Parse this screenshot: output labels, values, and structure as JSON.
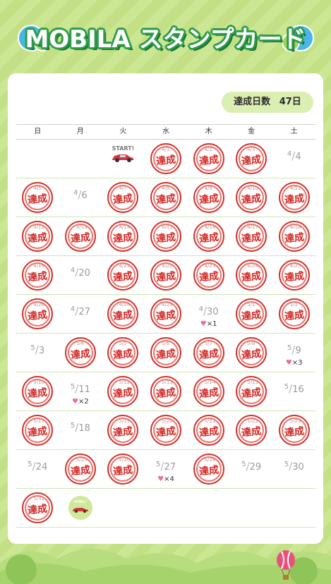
{
  "header": {
    "title": "MOBILA スタンプカード"
  },
  "badge": {
    "label": "達成日数",
    "value": "47日"
  },
  "weekdays": [
    "日",
    "月",
    "火",
    "水",
    "木",
    "金",
    "土"
  ],
  "stamp_text": "達成",
  "start_label": "START!",
  "goal_label": "GOAL!",
  "calendar": [
    [
      {
        "t": "empty"
      },
      {
        "t": "empty"
      },
      {
        "t": "start"
      },
      {
        "t": "stamp",
        "d": "4/1"
      },
      {
        "t": "stamp",
        "d": "4/2"
      },
      {
        "t": "stamp",
        "d": "4/3"
      },
      {
        "t": "date",
        "m": "4",
        "d": "4"
      }
    ],
    [
      {
        "t": "stamp",
        "d": "4/5"
      },
      {
        "t": "date",
        "m": "4",
        "d": "6"
      },
      {
        "t": "stamp",
        "d": "4/7"
      },
      {
        "t": "stamp",
        "d": "4/8"
      },
      {
        "t": "stamp",
        "d": "4/9"
      },
      {
        "t": "stamp",
        "d": "4/10"
      },
      {
        "t": "stamp",
        "d": "4/11"
      }
    ],
    [
      {
        "t": "stamp",
        "d": "4/12"
      },
      {
        "t": "stamp",
        "d": "4/13"
      },
      {
        "t": "stamp",
        "d": "4/14"
      },
      {
        "t": "stamp",
        "d": "4/15"
      },
      {
        "t": "stamp",
        "d": "4/16"
      },
      {
        "t": "stamp",
        "d": "4/17"
      },
      {
        "t": "stamp",
        "d": "4/18"
      }
    ],
    [
      {
        "t": "stamp",
        "d": "4/19"
      },
      {
        "t": "date",
        "m": "4",
        "d": "20"
      },
      {
        "t": "stamp",
        "d": "4/21"
      },
      {
        "t": "stamp",
        "d": "4/22"
      },
      {
        "t": "stamp",
        "d": "4/23"
      },
      {
        "t": "stamp",
        "d": "4/24"
      },
      {
        "t": "stamp",
        "d": "4/25"
      }
    ],
    [
      {
        "t": "stamp",
        "d": "4/26"
      },
      {
        "t": "date",
        "m": "4",
        "d": "27"
      },
      {
        "t": "stamp",
        "d": "4/28"
      },
      {
        "t": "stamp",
        "d": "4/29"
      },
      {
        "t": "date",
        "m": "4",
        "d": "30",
        "h": "×1"
      },
      {
        "t": "stamp",
        "d": "5/1"
      },
      {
        "t": "stamp",
        "d": "5/2"
      }
    ],
    [
      {
        "t": "date",
        "m": "5",
        "d": "3"
      },
      {
        "t": "stamp",
        "d": "5/4"
      },
      {
        "t": "stamp",
        "d": "5/5"
      },
      {
        "t": "stamp",
        "d": "5/6"
      },
      {
        "t": "stamp",
        "d": "5/7"
      },
      {
        "t": "stamp",
        "d": "5/8"
      },
      {
        "t": "date",
        "m": "5",
        "d": "9",
        "h": "×3"
      }
    ],
    [
      {
        "t": "stamp",
        "d": "5/10"
      },
      {
        "t": "date",
        "m": "5",
        "d": "11",
        "h": "×2"
      },
      {
        "t": "stamp",
        "d": "5/12"
      },
      {
        "t": "stamp",
        "d": "5/13"
      },
      {
        "t": "stamp",
        "d": "5/14"
      },
      {
        "t": "stamp",
        "d": "5/15"
      },
      {
        "t": "date",
        "m": "5",
        "d": "16"
      }
    ],
    [
      {
        "t": "stamp",
        "d": "5/17"
      },
      {
        "t": "date",
        "m": "5",
        "d": "18"
      },
      {
        "t": "stamp",
        "d": "5/19"
      },
      {
        "t": "stamp",
        "d": "5/20"
      },
      {
        "t": "stamp",
        "d": "5/21"
      },
      {
        "t": "stamp",
        "d": "5/22"
      },
      {
        "t": "stamp",
        "d": "5/23"
      }
    ],
    [
      {
        "t": "date",
        "m": "5",
        "d": "24"
      },
      {
        "t": "stamp",
        "d": "5/25"
      },
      {
        "t": "stamp",
        "d": "5/26"
      },
      {
        "t": "date",
        "m": "5",
        "d": "27",
        "h": "×4"
      },
      {
        "t": "stamp",
        "d": "5/28"
      },
      {
        "t": "date",
        "m": "5",
        "d": "29"
      },
      {
        "t": "date",
        "m": "5",
        "d": "30"
      }
    ],
    [
      {
        "t": "stamp",
        "d": "5/31"
      },
      {
        "t": "goal"
      },
      {
        "t": "empty"
      },
      {
        "t": "empty"
      },
      {
        "t": "empty"
      },
      {
        "t": "empty"
      },
      {
        "t": "empty"
      }
    ]
  ],
  "colors": {
    "bg": "#c9e58f",
    "stamp_red": "#d12824",
    "title_green": "#2d9b4a",
    "badge_bg": "#dcefb3"
  }
}
